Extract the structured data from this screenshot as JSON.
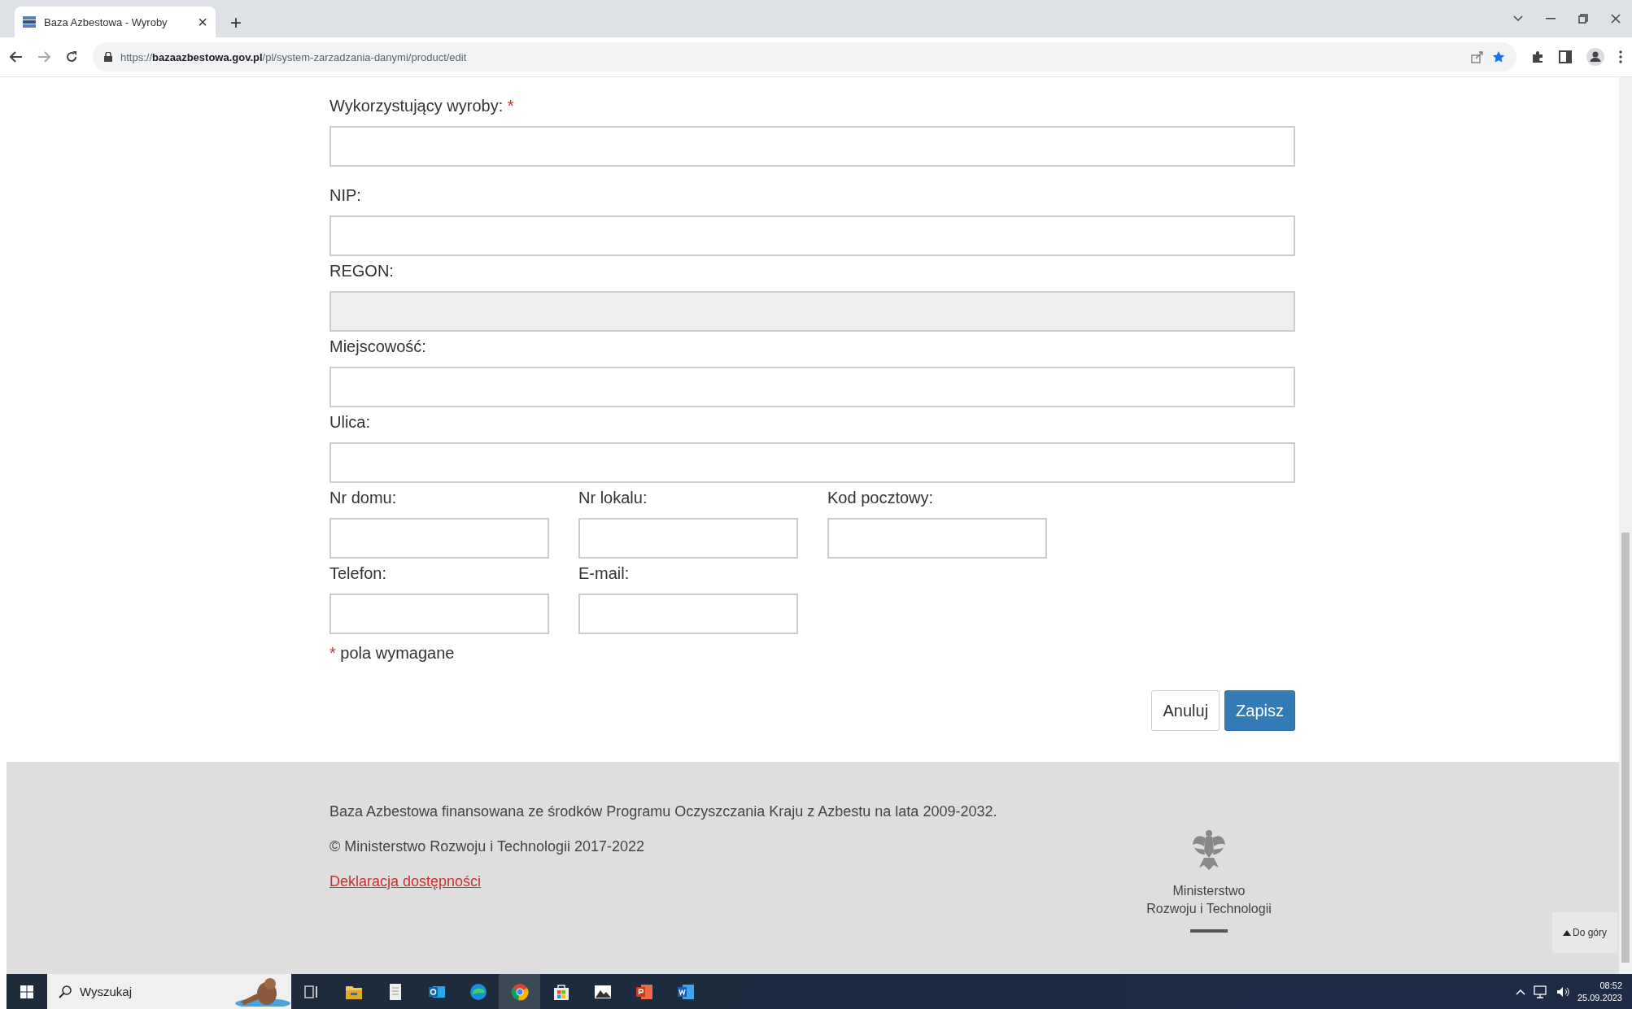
{
  "browser": {
    "tab": {
      "title": "Baza Azbestowa - Wyroby",
      "close": "×",
      "selected": true
    },
    "new_tab": "+",
    "url": "https://**bazaazbestowa.gov.pl**/pl/system-zarzadzania-danymi/product/edit"
  },
  "form": {
    "rows": [
      {
        "fields": [
          {
            "label": "Wykorzystujący wyroby:",
            "required_mark": "*",
            "disabled": false,
            "kind": "wide"
          }
        ]
      },
      {
        "fields": [
          {
            "label": "NIP:",
            "disabled": false,
            "kind": "wide"
          }
        ]
      },
      {
        "fields": [
          {
            "label": "REGON:",
            "disabled": true,
            "kind": "wide"
          }
        ]
      },
      {
        "fields": [
          {
            "label": "Miejscowość:",
            "disabled": false,
            "kind": "wide"
          }
        ]
      },
      {
        "fields": [
          {
            "label": "Ulica:",
            "disabled": false,
            "kind": "wide"
          }
        ]
      },
      {
        "fields": [
          {
            "label": "Nr domu:",
            "disabled": false,
            "kind": "narrow"
          },
          {
            "label": "Nr lokalu:",
            "disabled": false,
            "kind": "narrow"
          },
          {
            "label": "Kod pocztowy:",
            "disabled": false,
            "kind": "narrow"
          }
        ]
      },
      {
        "fields": [
          {
            "label": "Telefon:",
            "disabled": false,
            "kind": "narrow"
          },
          {
            "label": "E-mail:",
            "disabled": false,
            "kind": "narrow"
          }
        ]
      }
    ],
    "required_note": {
      "mark": "*",
      "text": "pola wymagane"
    },
    "buttons": [
      {
        "label": "Anuluj",
        "kind": "secondary"
      },
      {
        "label": "Zapisz",
        "kind": "primary"
      }
    ]
  },
  "footer": {
    "lines": [
      "Baza Azbestowa finansowana ze środków Programu Oczyszczania Kraju z Azbestu na lata 2009-2032.",
      "© Ministerstwo Rozwoju i Technologii 2017-2022"
    ],
    "link": "Deklaracja dostępności",
    "logo_text": [
      "Ministerstwo",
      "Rozwoju i Technologii"
    ],
    "back_to_top": "Do góry"
  },
  "taskbar": {
    "search_placeholder": "Wyszukaj",
    "apps": [
      {
        "kind": "task-view",
        "selected": false
      },
      {
        "kind": "folder",
        "selected": false
      },
      {
        "kind": "notepad",
        "selected": false
      },
      {
        "kind": "outlook",
        "selected": false
      },
      {
        "kind": "edge",
        "selected": false
      },
      {
        "kind": "chrome",
        "selected": true
      },
      {
        "kind": "store",
        "selected": false
      },
      {
        "kind": "photos",
        "selected": false
      },
      {
        "kind": "powerpoint",
        "selected": false
      },
      {
        "kind": "word",
        "selected": false
      }
    ],
    "time": "08:52",
    "date": "25.09.2023"
  }
}
